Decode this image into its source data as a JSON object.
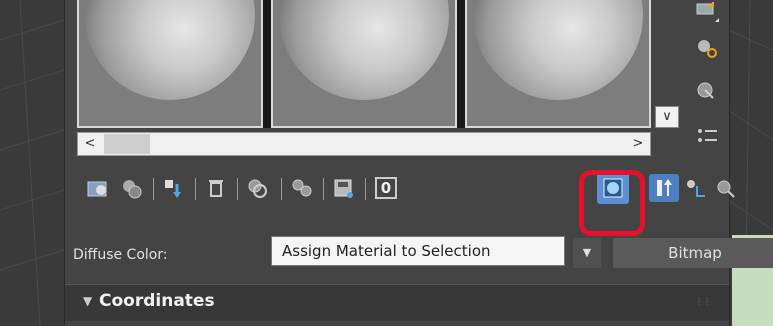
{
  "toolbar": {
    "buttons": [
      {
        "name": "get-material-icon"
      },
      {
        "name": "put-material-to-scene-icon"
      },
      {
        "name": "assign-material-to-selection-icon"
      },
      {
        "name": "reset-map-icon"
      },
      {
        "name": "make-unique-icon"
      },
      {
        "name": "put-to-library-icon"
      },
      {
        "name": "material-id-channel-icon"
      },
      {
        "name": "show-shaded-material-icon"
      },
      {
        "name": "show-end-result-icon"
      },
      {
        "name": "go-to-parent-icon"
      },
      {
        "name": "go-forward-to-sibling-icon"
      }
    ],
    "material_id_label": "0"
  },
  "diffuse": {
    "label": "Diffuse Color:",
    "bitmap_label": "Bitmap"
  },
  "tooltip": {
    "text": "Assign Material to Selection"
  },
  "rollout": {
    "title": "Coordinates"
  },
  "colors": {
    "highlight": "#e8102a",
    "panel": "#444444",
    "accent_blue": "#5b8fd6"
  }
}
